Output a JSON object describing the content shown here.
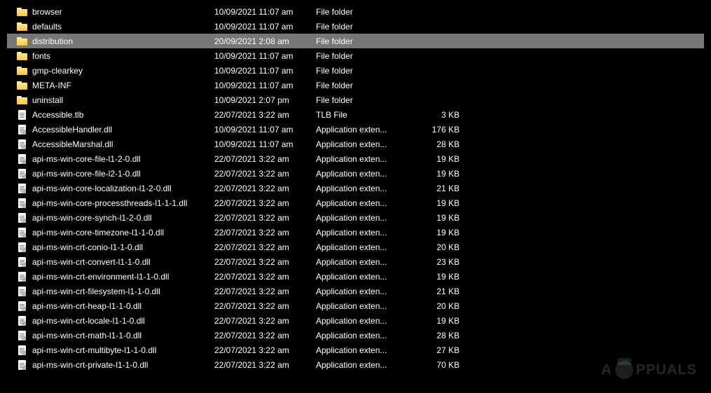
{
  "files": [
    {
      "name": "browser",
      "date": "10/09/2021 11:07 am",
      "type": "File folder",
      "size": "",
      "icon": "folder",
      "selected": false
    },
    {
      "name": "defaults",
      "date": "10/09/2021 11:07 am",
      "type": "File folder",
      "size": "",
      "icon": "folder",
      "selected": false
    },
    {
      "name": "distribution",
      "date": "20/09/2021 2:08 am",
      "type": "File folder",
      "size": "",
      "icon": "folder",
      "selected": true
    },
    {
      "name": "fonts",
      "date": "10/09/2021 11:07 am",
      "type": "File folder",
      "size": "",
      "icon": "folder",
      "selected": false
    },
    {
      "name": "gmp-clearkey",
      "date": "10/09/2021 11:07 am",
      "type": "File folder",
      "size": "",
      "icon": "folder",
      "selected": false
    },
    {
      "name": "META-INF",
      "date": "10/09/2021 11:07 am",
      "type": "File folder",
      "size": "",
      "icon": "folder",
      "selected": false
    },
    {
      "name": "uninstall",
      "date": "10/09/2021 2:07 pm",
      "type": "File folder",
      "size": "",
      "icon": "folder",
      "selected": false
    },
    {
      "name": "Accessible.tlb",
      "date": "22/07/2021 3:22 am",
      "type": "TLB File",
      "size": "3 KB",
      "icon": "file",
      "selected": false
    },
    {
      "name": "AccessibleHandler.dll",
      "date": "10/09/2021 11:07 am",
      "type": "Application exten...",
      "size": "176 KB",
      "icon": "dll",
      "selected": false
    },
    {
      "name": "AccessibleMarshal.dll",
      "date": "10/09/2021 11:07 am",
      "type": "Application exten...",
      "size": "28 KB",
      "icon": "dll",
      "selected": false
    },
    {
      "name": "api-ms-win-core-file-l1-2-0.dll",
      "date": "22/07/2021 3:22 am",
      "type": "Application exten...",
      "size": "19 KB",
      "icon": "dll",
      "selected": false
    },
    {
      "name": "api-ms-win-core-file-l2-1-0.dll",
      "date": "22/07/2021 3:22 am",
      "type": "Application exten...",
      "size": "19 KB",
      "icon": "dll",
      "selected": false
    },
    {
      "name": "api-ms-win-core-localization-l1-2-0.dll",
      "date": "22/07/2021 3:22 am",
      "type": "Application exten...",
      "size": "21 KB",
      "icon": "dll",
      "selected": false
    },
    {
      "name": "api-ms-win-core-processthreads-l1-1-1.dll",
      "date": "22/07/2021 3:22 am",
      "type": "Application exten...",
      "size": "19 KB",
      "icon": "dll",
      "selected": false
    },
    {
      "name": "api-ms-win-core-synch-l1-2-0.dll",
      "date": "22/07/2021 3:22 am",
      "type": "Application exten...",
      "size": "19 KB",
      "icon": "dll",
      "selected": false
    },
    {
      "name": "api-ms-win-core-timezone-l1-1-0.dll",
      "date": "22/07/2021 3:22 am",
      "type": "Application exten...",
      "size": "19 KB",
      "icon": "dll",
      "selected": false
    },
    {
      "name": "api-ms-win-crt-conio-l1-1-0.dll",
      "date": "22/07/2021 3:22 am",
      "type": "Application exten...",
      "size": "20 KB",
      "icon": "dll",
      "selected": false
    },
    {
      "name": "api-ms-win-crt-convert-l1-1-0.dll",
      "date": "22/07/2021 3:22 am",
      "type": "Application exten...",
      "size": "23 KB",
      "icon": "dll",
      "selected": false
    },
    {
      "name": "api-ms-win-crt-environment-l1-1-0.dll",
      "date": "22/07/2021 3:22 am",
      "type": "Application exten...",
      "size": "19 KB",
      "icon": "dll",
      "selected": false
    },
    {
      "name": "api-ms-win-crt-filesystem-l1-1-0.dll",
      "date": "22/07/2021 3:22 am",
      "type": "Application exten...",
      "size": "21 KB",
      "icon": "dll",
      "selected": false
    },
    {
      "name": "api-ms-win-crt-heap-l1-1-0.dll",
      "date": "22/07/2021 3:22 am",
      "type": "Application exten...",
      "size": "20 KB",
      "icon": "dll",
      "selected": false
    },
    {
      "name": "api-ms-win-crt-locale-l1-1-0.dll",
      "date": "22/07/2021 3:22 am",
      "type": "Application exten...",
      "size": "19 KB",
      "icon": "dll",
      "selected": false
    },
    {
      "name": "api-ms-win-crt-math-l1-1-0.dll",
      "date": "22/07/2021 3:22 am",
      "type": "Application exten...",
      "size": "28 KB",
      "icon": "dll",
      "selected": false
    },
    {
      "name": "api-ms-win-crt-multibyte-l1-1-0.dll",
      "date": "22/07/2021 3:22 am",
      "type": "Application exten...",
      "size": "27 KB",
      "icon": "dll",
      "selected": false
    },
    {
      "name": "api-ms-win-crt-private-l1-1-0.dll",
      "date": "22/07/2021 3:22 am",
      "type": "Application exten...",
      "size": "70 KB",
      "icon": "dll",
      "selected": false
    }
  ],
  "watermark": "PPUALS"
}
